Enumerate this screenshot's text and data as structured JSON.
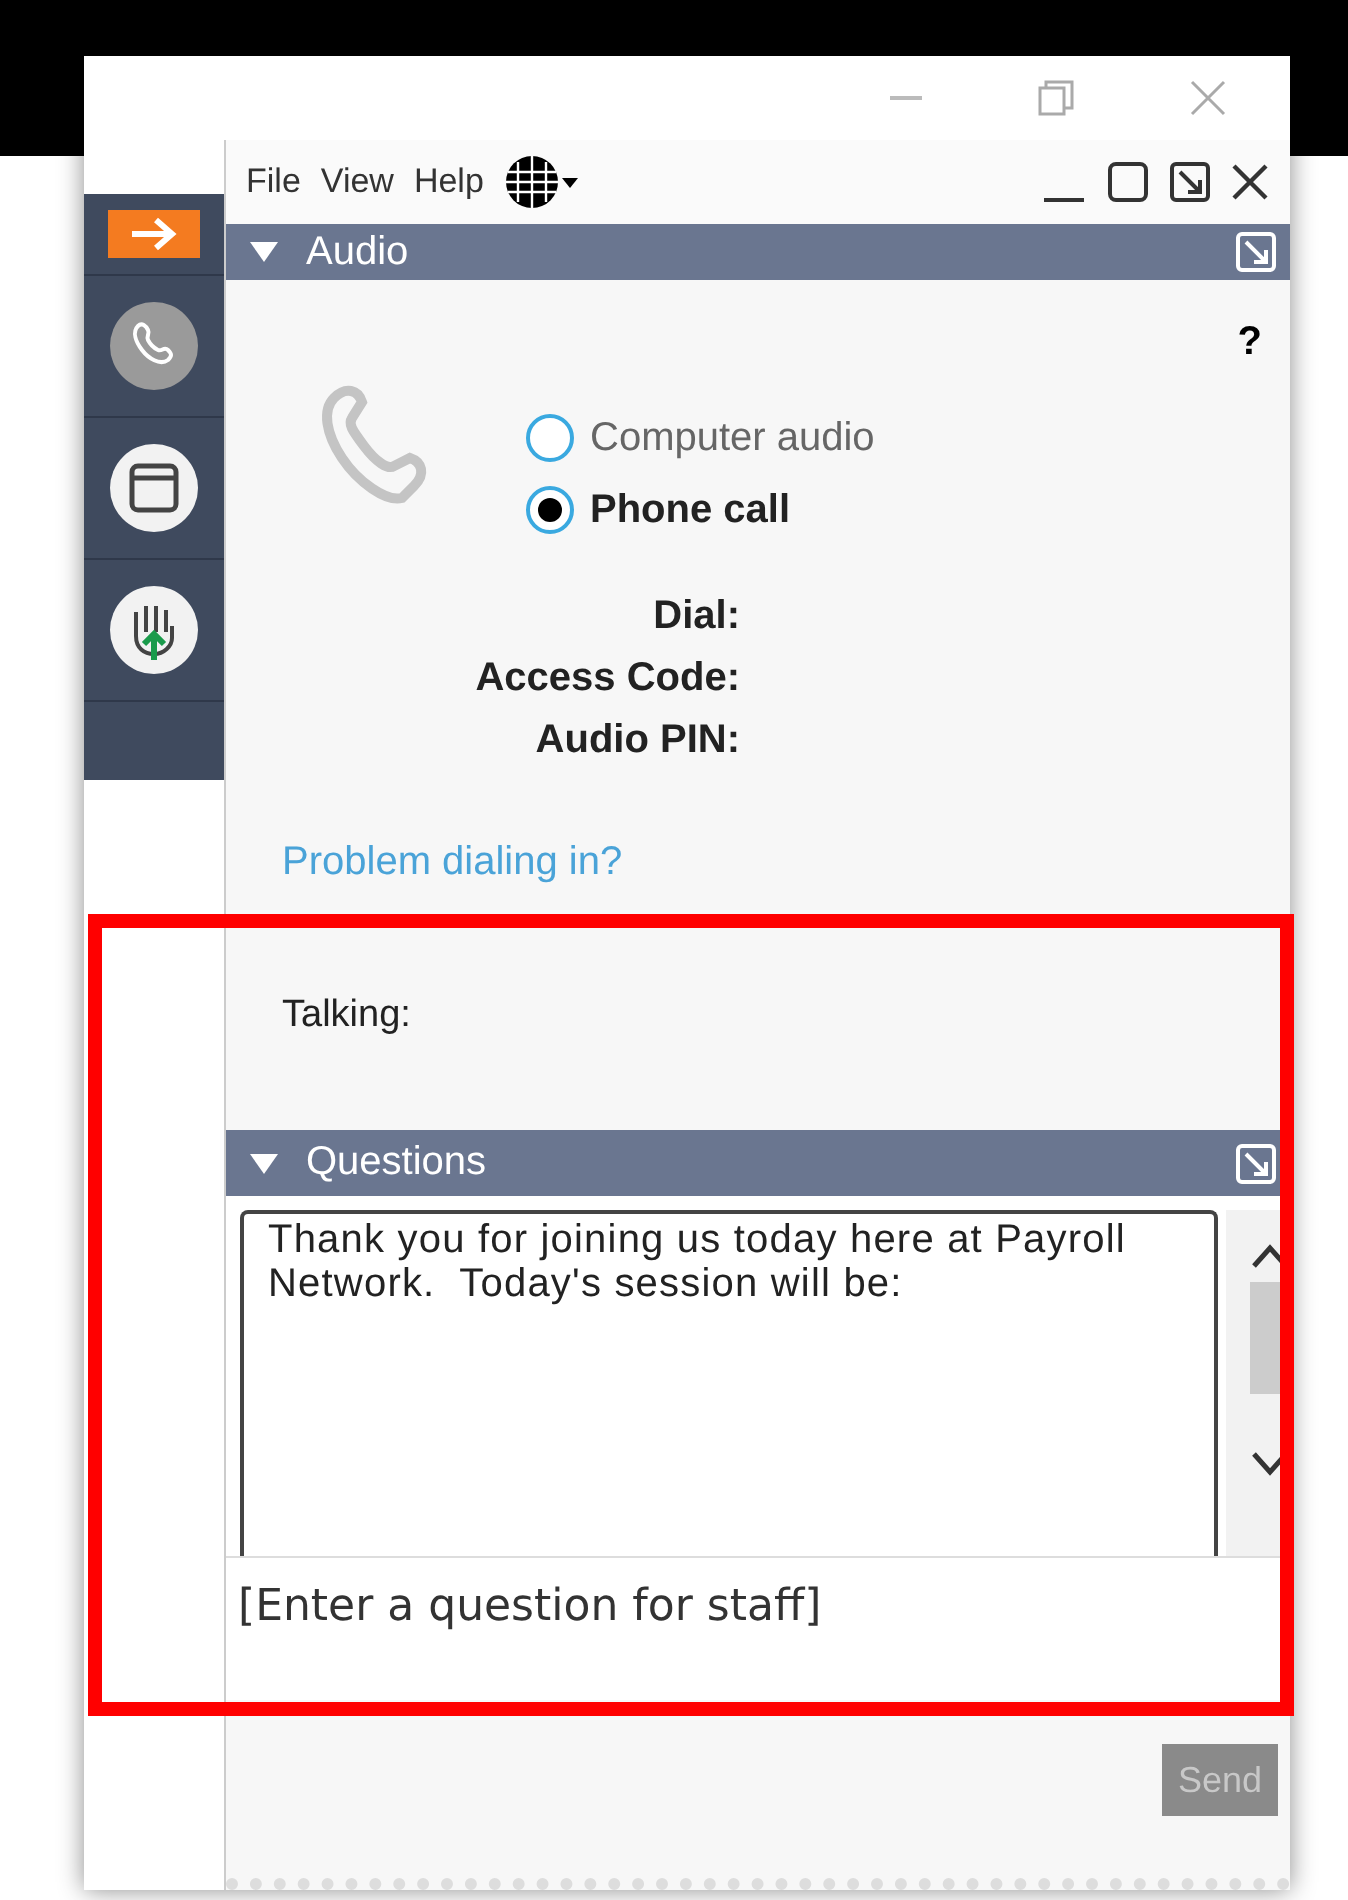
{
  "menu": [
    "File",
    "View",
    "Help"
  ],
  "sidebar": {
    "items": [
      {
        "kind": "arrow",
        "selected": true
      },
      {
        "kind": "phone",
        "selected": false
      },
      {
        "kind": "window",
        "selected": false
      },
      {
        "kind": "hand",
        "selected": false
      }
    ]
  },
  "audio": {
    "title": "Audio",
    "help": "?",
    "options": [
      {
        "label": "Computer audio",
        "selected": false
      },
      {
        "label": "Phone call",
        "selected": true
      }
    ],
    "fields": [
      "Dial:",
      "Access Code:",
      "Audio PIN:"
    ],
    "link": "Problem dialing in?",
    "talking_label": "Talking:"
  },
  "questions": {
    "title": "Questions",
    "message": "Thank you for joining us today here at Payroll Network.  Today's session will be:",
    "placeholder": "[Enter a question for staff]",
    "send_button": {
      "label": "Send",
      "disabled": true
    }
  }
}
